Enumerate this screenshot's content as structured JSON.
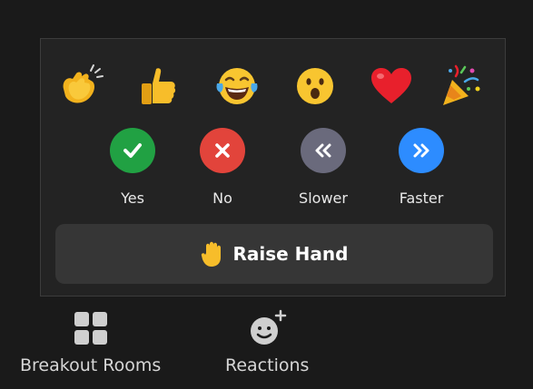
{
  "reactions": {
    "emojis": [
      {
        "icon": "clapping-hands-icon"
      },
      {
        "icon": "thumbs-up-icon"
      },
      {
        "icon": "tears-of-joy-icon"
      },
      {
        "icon": "open-mouth-icon"
      },
      {
        "icon": "red-heart-icon"
      },
      {
        "icon": "party-popper-icon"
      }
    ],
    "feedback": [
      {
        "label": "Yes",
        "icon": "check-icon",
        "color": "#21a143"
      },
      {
        "label": "No",
        "icon": "x-icon",
        "color": "#e2443b"
      },
      {
        "label": "Slower",
        "icon": "double-chevron-left-icon",
        "color": "#6a6a7c"
      },
      {
        "label": "Faster",
        "icon": "double-chevron-right-icon",
        "color": "#2d8cff"
      }
    ],
    "raise_hand_label": "Raise Hand",
    "raise_hand_icon": "raised-hand-icon"
  },
  "toolbar": {
    "breakout_label": "Breakout Rooms",
    "breakout_icon": "breakout-grid-icon",
    "reactions_label": "Reactions",
    "reactions_icon": "smiley-plus-icon"
  },
  "colors": {
    "background": "#1a1a1a",
    "popup": "#232323",
    "raise_hand_button": "#363636"
  }
}
